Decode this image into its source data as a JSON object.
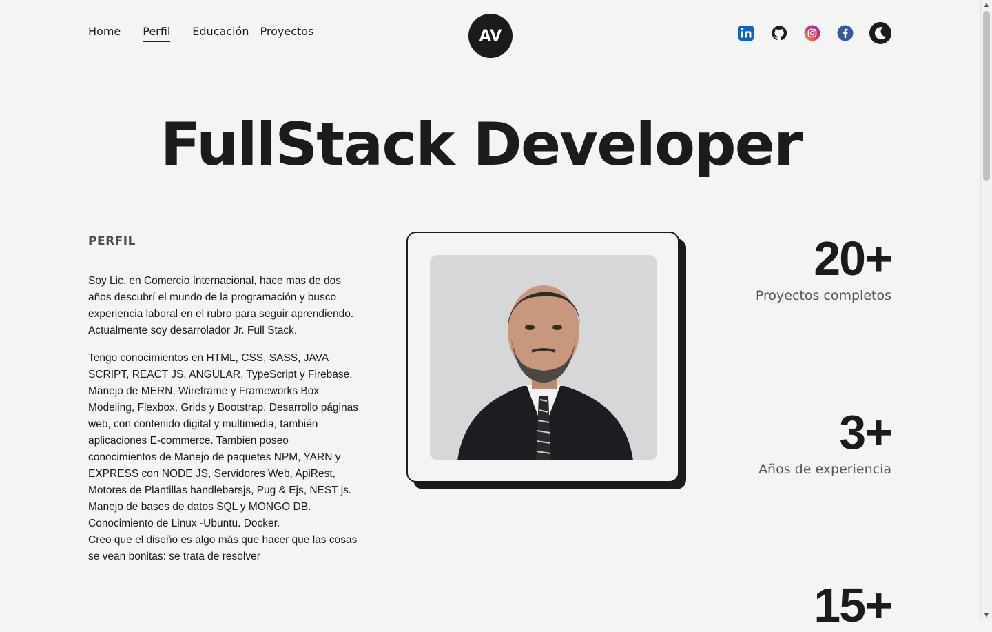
{
  "nav": {
    "items": [
      "Home",
      "Perfil",
      "Educación",
      "Proyectos"
    ],
    "active": "Perfil"
  },
  "logo": "AV",
  "socials": [
    "linkedin-icon",
    "github-icon",
    "instagram-icon",
    "facebook-icon",
    "dark-mode-icon"
  ],
  "hero": {
    "title": "FullStack Developer"
  },
  "profile": {
    "heading": "PERFIL",
    "paragraphs": [
      "Soy Lic. en Comercio Internacional, hace mas de dos años descubrí el mundo de la programación y busco experiencia laboral en el rubro para seguir aprendiendo. Actualmente soy desarrolador Jr. Full Stack.",
      "Tengo conocimientos en HTML, CSS, SASS, JAVA SCRIPT, REACT JS, ANGULAR, TypeScript y Firebase. Manejo de MERN, Wireframe y Frameworks Box Modeling, Flexbox, Grids y Bootstrap. Desarrollo páginas web, con contenido digital y multimedia, también aplicaciones E-commerce. Tambien poseo conocimientos de Manejo de paquetes NPM, YARN y EXPRESS con NODE JS, Servidores Web, ApiRest, Motores de Plantillas handlebarsjs, Pug & Ejs, NEST js. Manejo de bases de datos SQL y MONGO DB. Conocimiento de Linux -Ubuntu. Docker.",
      "Creo que el diseño es algo más que hacer que las cosas se vean bonitas: se trata de resolver"
    ]
  },
  "stats": [
    {
      "value": "20+",
      "label": "Proyectos completos"
    },
    {
      "value": "3+",
      "label": "Años de experiencia"
    },
    {
      "value": "15+",
      "label": ""
    }
  ],
  "colors": {
    "background": "#f4f4f4",
    "text": "#1b1b1b",
    "muted": "#555555"
  }
}
